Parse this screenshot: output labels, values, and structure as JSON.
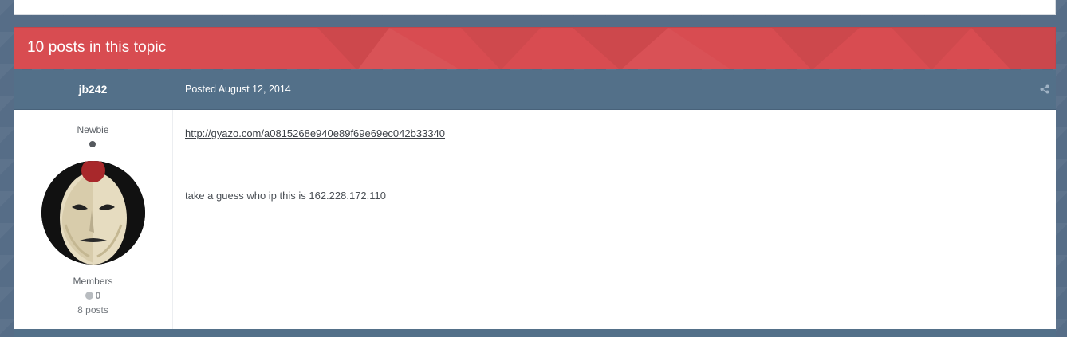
{
  "topic": {
    "title": "10 posts in this topic"
  },
  "post": {
    "author": {
      "name": "jb242",
      "rank": "Newbie",
      "group": "Members",
      "reputation": "0",
      "post_count": "8 posts",
      "avatar_icon": "avatar-mask-icon"
    },
    "posted": "Posted August 12, 2014",
    "share_icon": "share-icon",
    "link": "http://gyazo.com/a0815268e940e89f69e69ec042b33340",
    "text": "take a guess who ip this is 162.228.172.110"
  },
  "colors": {
    "header_red": "#d84c51",
    "post_bar_blue": "#537089",
    "page_background": "#566d87"
  }
}
